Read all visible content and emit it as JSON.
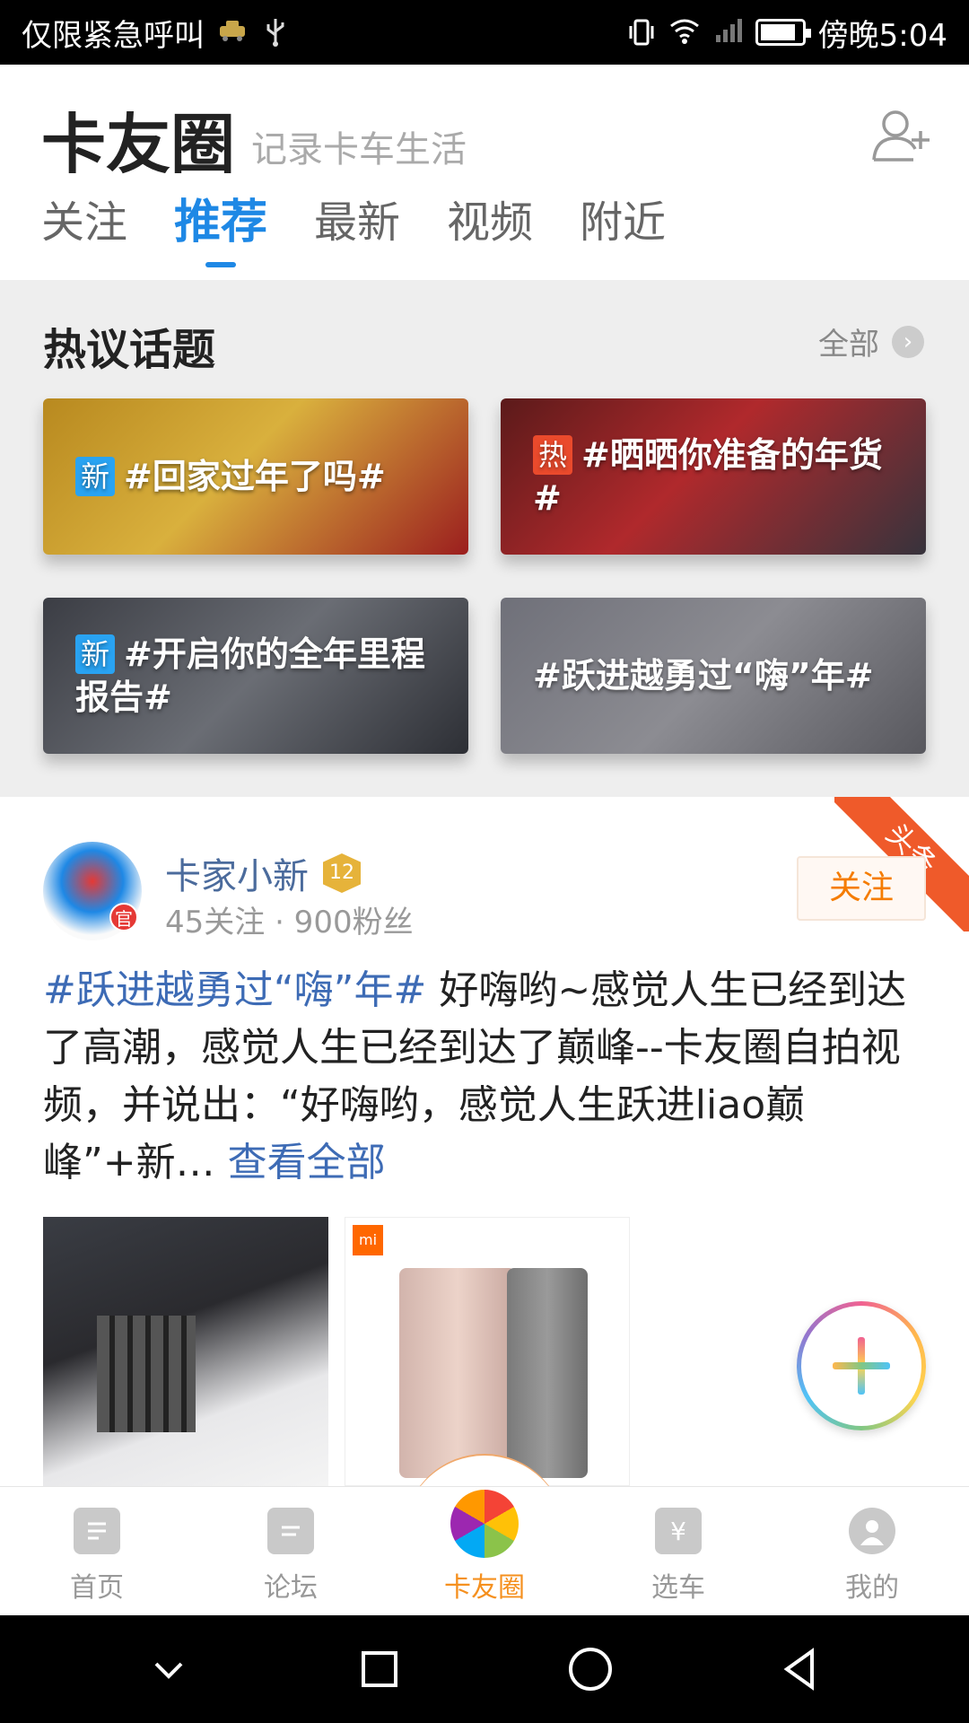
{
  "status_bar": {
    "carrier": "仅限紧急呼叫",
    "time": "傍晚5:04",
    "left_icons": [
      "taxi-icon",
      "usb-icon"
    ],
    "right_icons": [
      "vibrate-icon",
      "wifi-icon",
      "signal-icon",
      "battery-icon"
    ]
  },
  "header": {
    "title": "卡友圈",
    "subtitle": "记录卡车生活",
    "tabs": [
      {
        "label": "关注"
      },
      {
        "label": "推荐",
        "active": true
      },
      {
        "label": "最新"
      },
      {
        "label": "视频"
      },
      {
        "label": "附近"
      }
    ]
  },
  "topics": {
    "title": "热议话题",
    "all_label": "全部",
    "cards": [
      {
        "badge": "新",
        "text": "#回家过年了吗#"
      },
      {
        "badge": "热",
        "text": "#晒晒你准备的年货#"
      },
      {
        "badge": "新",
        "text": "#开启你的全年里程报告#"
      },
      {
        "badge": "",
        "text": "#跃进越勇过“嗨”年#"
      }
    ]
  },
  "post": {
    "corner_label": "头条",
    "author": "卡家小新",
    "level": "12",
    "official_badge": "官",
    "meta": "45关注 · 900粉丝",
    "follow_label": "关注",
    "hashtag": "#跃进越勇过“嗨”年#",
    "text": " 好嗨哟~感觉人生已经到达了高潮，感觉人生已经到达了巅峰--卡友圈自拍视频，并说出：“好嗨哟，感觉人生跃进liao巅峰”+新…",
    "view_all": "查看全部",
    "images": [
      "organizer-binder-image",
      "mi-power-bank-image"
    ],
    "mi_logo": "mi"
  },
  "bottom_nav": {
    "items": [
      {
        "label": "首页",
        "icon": "home-doc-icon"
      },
      {
        "label": "论坛",
        "icon": "forum-chat-icon"
      },
      {
        "label": "卡友圈",
        "icon": "pinwheel-icon",
        "active": true
      },
      {
        "label": "选车",
        "icon": "truck-icon",
        "icon_text": "¥"
      },
      {
        "label": "我的",
        "icon": "profile-icon"
      }
    ]
  },
  "colors": {
    "accent_blue": "#1e88e5",
    "active_orange": "#f5901f",
    "link_blue": "#3d6bb5",
    "hot_red": "#ea4a2c",
    "new_blue": "#29a3f2"
  }
}
